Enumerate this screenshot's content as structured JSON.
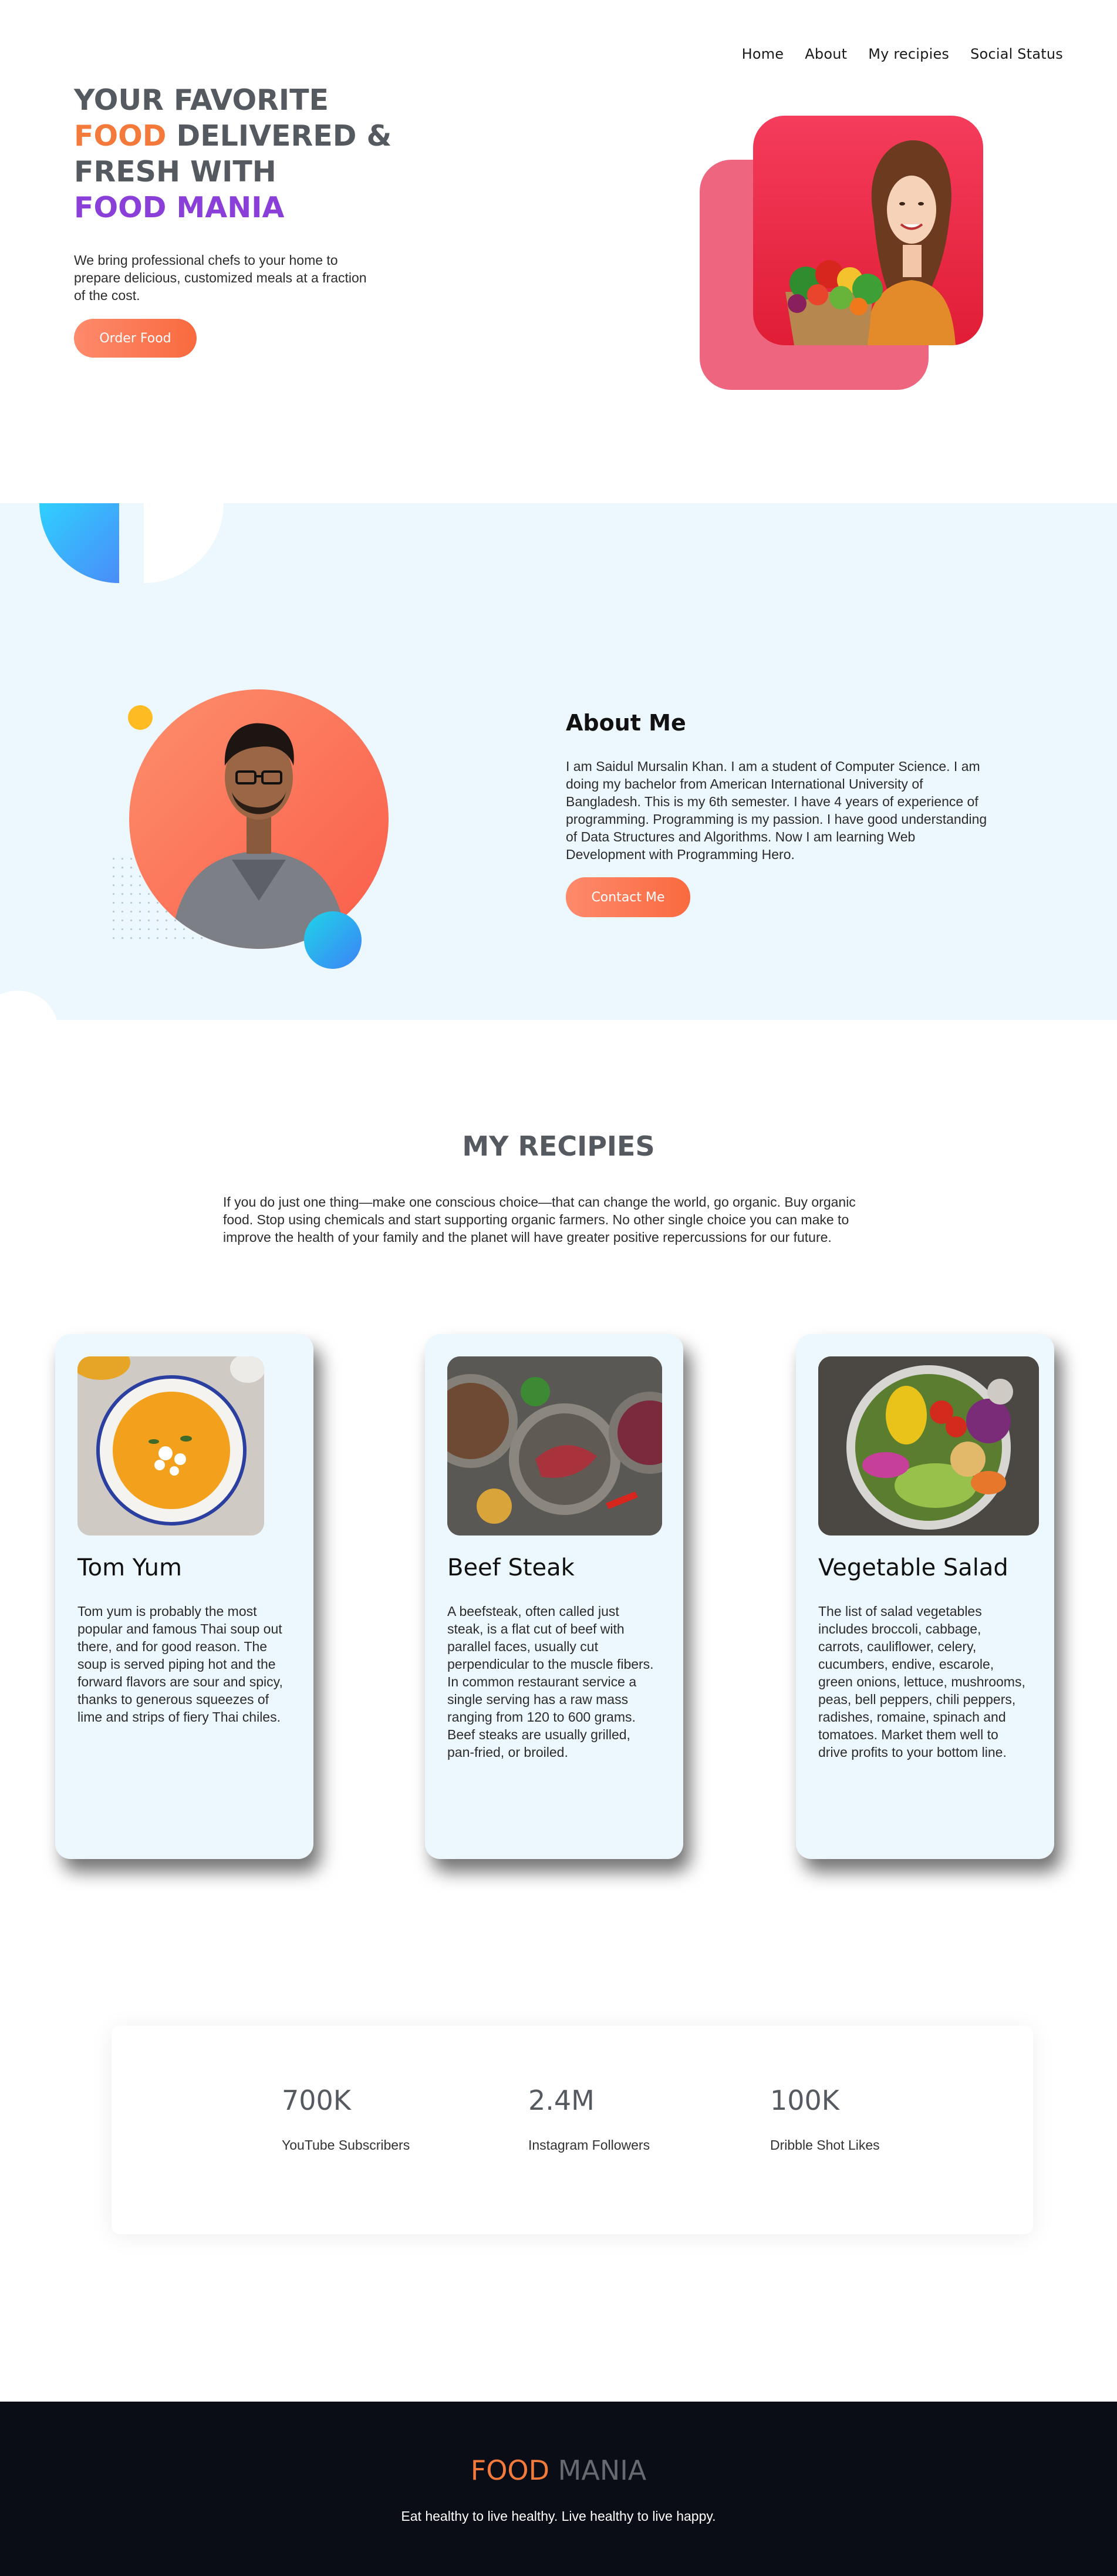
{
  "nav": {
    "items": [
      "Home",
      "About",
      "My recipies",
      "Social Status"
    ]
  },
  "hero": {
    "line1": "YOUR FAVORITE",
    "food_word": "FOOD",
    "line2_rest": " DELIVERED &",
    "line3": "FRESH WITH",
    "brand": "FOOD MANIA",
    "description": "We bring professional chefs to your home to prepare delicious, customized meals at a fraction of the cost.",
    "cta_label": "Order Food"
  },
  "about": {
    "title": "About Me",
    "text": "I am Saidul Mursalin Khan. I am a student of Computer Science. I am doing my bachelor from American International University of Bangladesh. This is my 6th semester. I have 4 years of experience of programming. Programming is my passion. I have good understanding of Data Structures and Algorithms. Now I am learning Web Development with Programming Hero.",
    "cta_label": "Contact Me"
  },
  "recipes": {
    "title": "MY RECIPIES",
    "intro": "If you do just one thing—make one conscious choice—that can change the world, go organic. Buy organic food. Stop using chemicals and start supporting organic farmers. No other single choice you can make to improve the health of your family and the planet will have greater positive repercussions for our future.",
    "cards": [
      {
        "title": "Tom Yum",
        "text": "Tom yum is probably the most popular and famous Thai soup out there, and for good reason. The soup is served piping hot and the forward flavors are sour and spicy, thanks to generous squeezes of lime and strips of fiery Thai chiles."
      },
      {
        "title": "Beef Steak",
        "text": "A beefsteak, often called just steak, is a flat cut of beef with parallel faces, usually cut perpendicular to the muscle fibers. In common restaurant service a single serving has a raw mass ranging from 120 to 600 grams. Beef steaks are usually grilled, pan-fried, or broiled."
      },
      {
        "title": "Vegetable Salad",
        "text": "The list of salad vegetables includes broccoli, cabbage, carrots, cauliflower, celery, cucumbers, endive, escarole, green onions, lettuce, mushrooms, peas, bell peppers, chili peppers, radishes, romaine, spinach and tomatoes. Market them well to drive profits to your bottom line."
      }
    ]
  },
  "stats": [
    {
      "value": "700K",
      "label": "YouTube Subscribers"
    },
    {
      "value": "2.4M",
      "label": "Instagram Followers"
    },
    {
      "value": "100K",
      "label": "Dribble Shot Likes"
    }
  ],
  "footer": {
    "brand_first": "FOOD",
    "brand_second": "MANIA",
    "tagline": "Eat healthy to live healthy. Live healthy to live happy."
  },
  "colors": {
    "accent_orange": "#f47a3c",
    "accent_purple": "#8b3fd9",
    "about_bg": "#edf7fe",
    "footer_bg": "#0b0d16",
    "hero_red": "#e01d35"
  }
}
